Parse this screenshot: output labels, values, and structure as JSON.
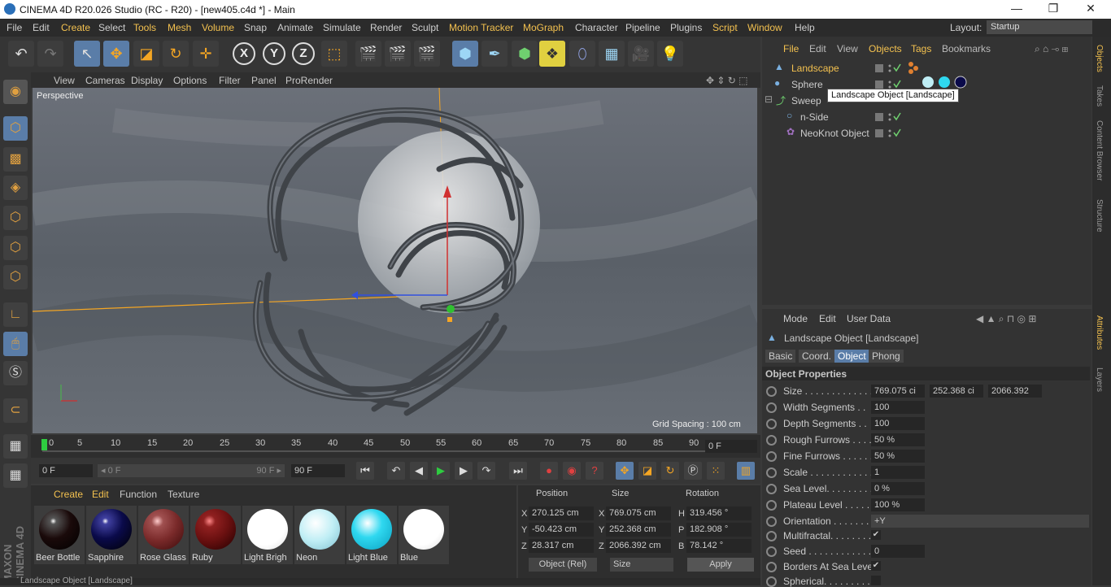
{
  "window": {
    "title": "CINEMA 4D R20.026 Studio (RC - R20) - [new405.c4d *] - Main",
    "min": "—",
    "max": "❐",
    "close": "✕"
  },
  "menu": [
    "File",
    "Edit",
    "Create",
    "Select",
    "Tools",
    "Mesh",
    "Volume",
    "Snap",
    "Animate",
    "Simulate",
    "Render",
    "Sculpt",
    "Motion Tracker",
    "MoGraph",
    "Character",
    "Pipeline",
    "Plugins",
    "Script",
    "Window",
    "Help"
  ],
  "layout": {
    "label": "Layout:",
    "value": "Startup"
  },
  "toolbar": {
    "x": "X",
    "y": "Y",
    "z": "Z"
  },
  "viewport": {
    "menu": [
      "View",
      "Cameras",
      "Display",
      "Options",
      "Filter",
      "Panel",
      "ProRender"
    ],
    "label": "Perspective",
    "grid": "Grid Spacing : 100 cm"
  },
  "timeline": {
    "ticks": [
      "0",
      "5",
      "10",
      "15",
      "20",
      "25",
      "30",
      "35",
      "40",
      "45",
      "50",
      "55",
      "60",
      "65",
      "70",
      "75",
      "80",
      "85",
      "90"
    ],
    "frame": "0 F"
  },
  "playbar": {
    "start": "0 F",
    "range_start": "◂ 0 F",
    "range_end": "90 F ▸",
    "end": "90 F"
  },
  "materials": {
    "menu": [
      "Create",
      "Edit",
      "Function",
      "Texture"
    ],
    "items": [
      {
        "name": "Beer Bottle",
        "color": "#1a0a0a"
      },
      {
        "name": "Sapphire",
        "color": "#0a0a4a"
      },
      {
        "name": "Rose Glass",
        "color": "#7a2a2a"
      },
      {
        "name": "Ruby",
        "color": "#6a1010"
      },
      {
        "name": "Light Brigh",
        "color": "#ffffff"
      },
      {
        "name": "Neon",
        "color": "#bfeef5"
      },
      {
        "name": "Light Blue",
        "color": "#2fd8f0"
      },
      {
        "name": "Blue",
        "color": "#ffffff"
      }
    ]
  },
  "coords": {
    "headers": {
      "position": "Position",
      "size": "Size",
      "rotation": "Rotation"
    },
    "rows": [
      {
        "axis": "X",
        "pos": "270.125 cm",
        "saxis": "X",
        "size": "769.075 cm",
        "raxis": "H",
        "rot": "319.456 °"
      },
      {
        "axis": "Y",
        "pos": "-50.423 cm",
        "saxis": "Y",
        "size": "252.368 cm",
        "raxis": "P",
        "rot": "182.908 °"
      },
      {
        "axis": "Z",
        "pos": "28.317 cm",
        "saxis": "Z",
        "size": "2066.392 cm",
        "raxis": "B",
        "rot": "78.142 °"
      }
    ],
    "mode": "Object (Rel)",
    "sizemode": "Size",
    "apply": "Apply"
  },
  "objects": {
    "menu": [
      "File",
      "Edit",
      "View",
      "Objects",
      "Tags",
      "Bookmarks"
    ],
    "items": [
      {
        "name": "Landscape"
      },
      {
        "name": "Sphere"
      },
      {
        "name": "Sweep"
      },
      {
        "name": "n-Side"
      },
      {
        "name": "NeoKnot Object"
      }
    ],
    "tooltip": "Landscape Object [Landscape]"
  },
  "attributes": {
    "menu": [
      "Mode",
      "Edit",
      "User Data"
    ],
    "title": "Landscape Object [Landscape]",
    "tabs": [
      "Basic",
      "Coord.",
      "Object",
      "Phong"
    ],
    "section": "Object Properties",
    "size": [
      "769.075 ci",
      "252.368 ci",
      "2066.392"
    ],
    "props": [
      {
        "label": "Size . . . . . . . . . . . . . . ."
      },
      {
        "label": "Width Segments . .",
        "value": "100"
      },
      {
        "label": "Depth Segments . .",
        "value": "100"
      },
      {
        "label": "Rough Furrows . . . .",
        "value": "50 %"
      },
      {
        "label": "Fine Furrows . . . . . .",
        "value": "50 %"
      },
      {
        "label": "Scale . . . . . . . . . . . .",
        "value": "1"
      },
      {
        "label": "Sea Level. . . . . . . . .",
        "value": "0 %"
      },
      {
        "label": "Plateau Level . . . . .",
        "value": "100 %"
      },
      {
        "label": "Orientation . . . . . . .",
        "value": "+Y"
      },
      {
        "label": "Multifractal. . . . . . . .",
        "value": "✔"
      },
      {
        "label": "Seed . . . . . . . . . . . .",
        "value": "0"
      },
      {
        "label": "Borders At Sea Level",
        "value": "✔"
      },
      {
        "label": "Spherical. . . . . . . . . .",
        "value": ""
      }
    ]
  },
  "sidetabs": [
    "Objects",
    "Takes",
    "Content Browser",
    "Structure",
    "Attributes",
    "Layers"
  ],
  "status": "Landscape Object [Landscape]",
  "brand": "MAXON CINEMA 4D"
}
